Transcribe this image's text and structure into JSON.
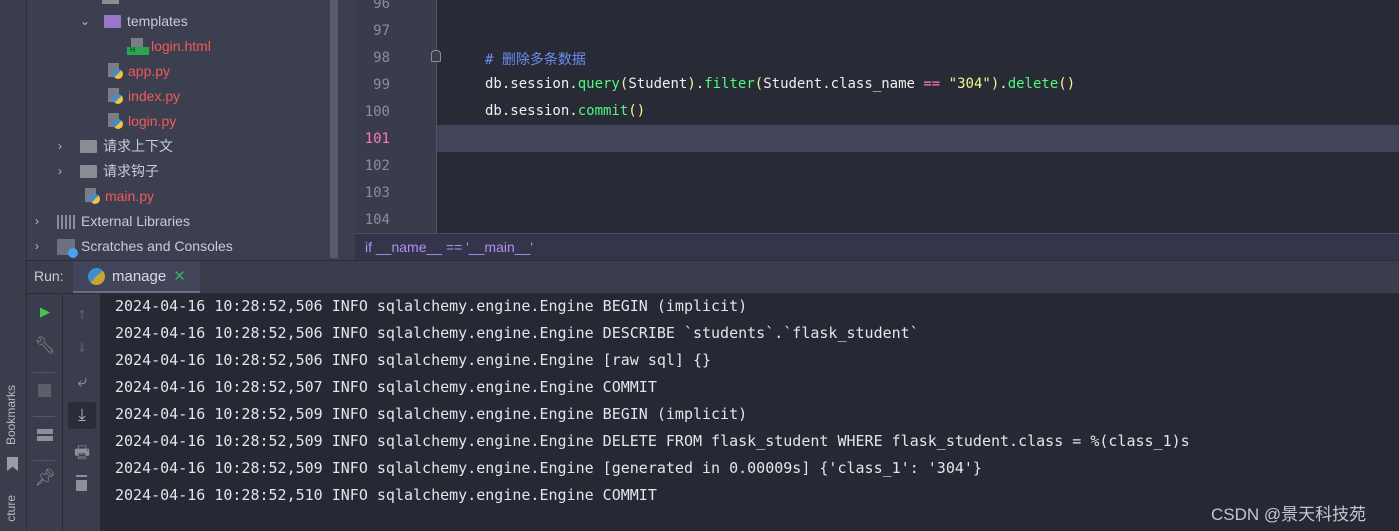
{
  "left_strip": {
    "bookmarks": "Bookmarks",
    "structure": "cture"
  },
  "tree": {
    "items": [
      {
        "label": "templates",
        "type": "folder-purple",
        "expanded": true
      },
      {
        "label": "login.html",
        "type": "html",
        "status": "unversioned"
      },
      {
        "label": "app.py",
        "type": "python",
        "status": "unversioned"
      },
      {
        "label": "index.py",
        "type": "python",
        "status": "unversioned"
      },
      {
        "label": "login.py",
        "type": "python",
        "status": "unversioned"
      },
      {
        "label": "请求上下文",
        "type": "folder",
        "expanded": false
      },
      {
        "label": "请求钩子",
        "type": "folder",
        "expanded": false
      },
      {
        "label": "main.py",
        "type": "python",
        "status": "unversioned"
      },
      {
        "label": "External Libraries",
        "type": "libraries",
        "expanded": false
      },
      {
        "label": "Scratches and Consoles",
        "type": "scratches",
        "expanded": false
      }
    ]
  },
  "editor": {
    "line_numbers": [
      "96",
      "97",
      "98",
      "99",
      "100",
      "101",
      "102",
      "103",
      "104"
    ],
    "current_line": "101",
    "comment": "# 删除多条数据",
    "line99": {
      "a": "db.session.",
      "b": "query",
      "c": "(",
      "d": "Student",
      "e": ")",
      "f": ".",
      "g": "filter",
      "h": "(",
      "i": "Student.class_name ",
      "j": "==",
      "k": " ",
      "l": "\"304\"",
      "m": ")",
      "n": ".",
      "o": "delete",
      "p": "()"
    },
    "line100": {
      "a": "db.session.",
      "b": "commit",
      "c": "()"
    },
    "breadcrumb": "if __name__ == '__main__'"
  },
  "run": {
    "label": "Run:",
    "tab": "manage"
  },
  "console": [
    "2024-04-16 10:28:52,506 INFO sqlalchemy.engine.Engine BEGIN (implicit)",
    "2024-04-16 10:28:52,506 INFO sqlalchemy.engine.Engine DESCRIBE `students`.`flask_student`",
    "2024-04-16 10:28:52,506 INFO sqlalchemy.engine.Engine [raw sql] {}",
    "2024-04-16 10:28:52,507 INFO sqlalchemy.engine.Engine COMMIT",
    "2024-04-16 10:28:52,509 INFO sqlalchemy.engine.Engine BEGIN (implicit)",
    "2024-04-16 10:28:52,509 INFO sqlalchemy.engine.Engine DELETE FROM flask_student WHERE flask_student.class = %(class_1)s",
    "2024-04-16 10:28:52,509 INFO sqlalchemy.engine.Engine [generated in 0.00009s] {'class_1': '304'}",
    "2024-04-16 10:28:52,510 INFO sqlalchemy.engine.Engine COMMIT"
  ],
  "watermark": "CSDN @景天科技苑",
  "colors": {
    "keyword_fn": "#50fa7b",
    "paren": "#f1fa8c",
    "comment": "#6c8cf0",
    "operator": "#ff79c6",
    "unversioned": "#f05a5a"
  }
}
